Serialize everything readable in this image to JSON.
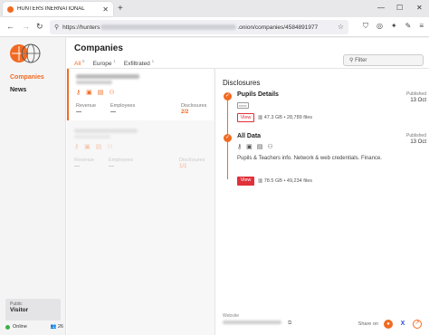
{
  "browser": {
    "tab_title": "HUNTERS INERNATIONAL",
    "url_prefix": "https://hunters",
    "url_suffix": ".onion/companies/4584891977"
  },
  "sidebar": {
    "items": [
      {
        "label": "Companies",
        "active": true
      },
      {
        "label": "News",
        "active": false
      }
    ],
    "visitor_label": "Public",
    "visitor_value": "Visitor",
    "status_label": "Online",
    "visitor_count": "26"
  },
  "main": {
    "title": "Companies",
    "filters": [
      {
        "label": "All",
        "count": "5"
      },
      {
        "label": "Europe",
        "count": "1"
      },
      {
        "label": "Exfiltrated",
        "count": "1"
      }
    ],
    "filter_placeholder": "Filter"
  },
  "companies": [
    {
      "revenue_label": "Revenue",
      "revenue": "—",
      "employees_label": "Employees",
      "employees": "—",
      "disclosures_label": "Disclosures",
      "disclosures": "2/2"
    },
    {
      "revenue_label": "Revenue",
      "revenue": "—",
      "employees_label": "Employees",
      "employees": "—",
      "disclosures_label": "Disclosures",
      "disclosures": "1/1"
    }
  ],
  "detail": {
    "heading": "Disclosures",
    "entries": [
      {
        "title": "Pupils Details",
        "published_label": "Published",
        "published_date": "13 Oct",
        "view_label": "View",
        "size": "47.3 GB",
        "files": "28,789 files"
      },
      {
        "title": "All Data",
        "published_label": "Published",
        "published_date": "13 Oct",
        "description": "Pupils & Teachers info. Network & web credentials. Finance.",
        "view_label": "View",
        "size": "78.5 GB",
        "files": "49,234 files"
      }
    ],
    "website_label": "Website",
    "share_label": "Share on"
  },
  "colors": {
    "accent": "#f26a21",
    "danger": "#e0303a",
    "online": "#3cb043"
  }
}
